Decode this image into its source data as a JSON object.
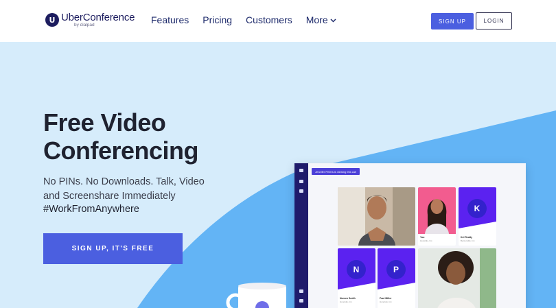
{
  "nav": {
    "logo_badge": "U",
    "logo_name": "UberConference",
    "logo_sub": "by dialpad",
    "menu": [
      {
        "label": "Features"
      },
      {
        "label": "Pricing"
      },
      {
        "label": "Customers"
      },
      {
        "label": "More"
      }
    ],
    "signup_label": "SIGN UP",
    "login_label": "LOGIN"
  },
  "hero": {
    "headline_line1": "Free Video",
    "headline_line2": "Conferencing",
    "subtext": "No PINs. No Downloads. Talk, Video and Screenshare Immediately",
    "hashtag": "#WorkFromAnywhere",
    "cta_label": "SIGN UP, IT'S FREE"
  },
  "app_mockup": {
    "banner": "Jennifer Peters is viewing this call",
    "tiles": [
      {
        "name": "",
        "location": ""
      },
      {
        "name": "You",
        "location": "Honolulu, Inc."
      },
      {
        "name": "Kel Reddy",
        "location": "Bentonville, Inc.",
        "letter": "K"
      },
      {
        "name": "Noreen Smith",
        "location": "Honolulu, Inc.",
        "letter": "N"
      },
      {
        "name": "Paul Miller",
        "location": "Honolulu, Inc.",
        "letter": "P"
      },
      {
        "name": "",
        "location": ""
      }
    ]
  },
  "colors": {
    "primary": "#4b5fe0",
    "navy": "#1d1d5f",
    "hero_bg": "#d6ecfb",
    "hero_blob": "#63b4f5"
  }
}
